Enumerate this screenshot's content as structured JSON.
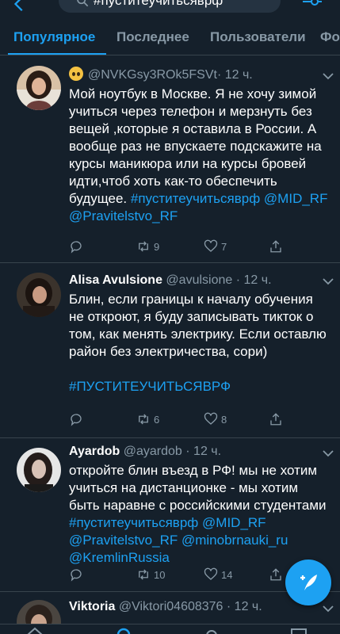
{
  "search": {
    "query": "#пуститеучитьсяврф"
  },
  "tabs": [
    {
      "label": "Популярное",
      "active": true
    },
    {
      "label": "Последнее",
      "active": false
    },
    {
      "label": "Пользователи",
      "active": false
    },
    {
      "label": "Фото",
      "active": false
    }
  ],
  "tweets": [
    {
      "name": "",
      "handle": "@NVKGsy3ROk5FSVt",
      "time": "· 12 ч.",
      "text_plain": "Мой ноутбук в Москве. Я не хочу зимой учиться через телефон и мерзнуть без вещей ,которые я оставила в России. А вообще раз не впускаете подскажите на курсы маникюра или на курсы бровей идти,чтоб хоть как-то обеспечить будущее.",
      "tags": [
        "#пуститеучитьсяврф",
        "@MID_RF",
        "@Pravitelstvo_RF"
      ],
      "retweets": "9",
      "likes": "7"
    },
    {
      "name": "Alisa Avulsione",
      "handle": "@avulsione",
      "time": "· 12 ч.",
      "text_plain": "Блин, если границы к началу обучения не откроют, я буду записывать тикток о том, как менять электрику. Если оставлю район без электричества, сори)",
      "tags": [
        "#ПУСТИТЕУЧИТЬСЯВРФ"
      ],
      "retweets": "6",
      "likes": "8"
    },
    {
      "name": "Ayardob",
      "handle": "@ayardob",
      "time": "· 12 ч.",
      "text_plain": "откройте блин въезд в РФ! мы не хотим учиться на дистанционке - мы хотим быть наравне с российскими студентами",
      "tags": [
        "#пуститеучитьсяврф",
        "@MID_RF",
        "@Pravitelstvo_RF",
        "@minobrnauki_ru",
        "@KremlinRussia"
      ],
      "retweets": "10",
      "likes": "14"
    },
    {
      "name": "Viktoria",
      "handle": "@Viktori04608376",
      "time": "· 12 ч."
    }
  ],
  "icons": {
    "back": "chevron-left-icon",
    "search": "search-icon",
    "filter": "sliders-icon",
    "reply": "comment-icon",
    "retweet": "retweet-icon",
    "like": "heart-icon",
    "share": "share-icon",
    "compose": "compose-tweet-icon"
  },
  "colors": {
    "background": "#15202b",
    "accent": "#1da1f2",
    "muted": "#8899a6",
    "divider": "#38444d"
  }
}
